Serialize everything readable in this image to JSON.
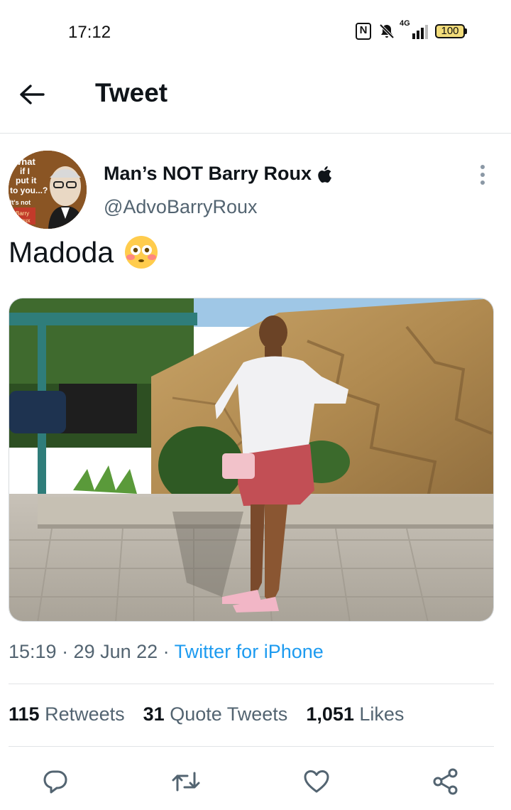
{
  "status_bar": {
    "time": "17:12",
    "network_label": "4G",
    "battery": "100",
    "icons": [
      "nfc-icon",
      "silent-bell-icon",
      "signal-icon",
      "battery-icon"
    ]
  },
  "header": {
    "title": "Tweet",
    "back_icon": "back-arrow-icon"
  },
  "tweet": {
    "author": {
      "display_name": "Man’s NOT Barry Roux",
      "handle": "@AdvoBarryRoux",
      "avatar_caption": [
        "What",
        "if I",
        "put it",
        "to you...?",
        "It's not",
        "Barry",
        "Roux"
      ]
    },
    "text": "Madoda",
    "emoji": "flushed-face",
    "media_alt": "photo",
    "timestamp": "15:19 · 29 Jun 22 · ",
    "source": "Twitter for iPhone",
    "stats": {
      "retweets_count": "115",
      "retweets_label": "Retweets",
      "quotes_count": "31",
      "quotes_label": "Quote Tweets",
      "likes_count": "1,051",
      "likes_label": "Likes"
    },
    "actions": [
      "reply-icon",
      "retweet-icon",
      "like-icon",
      "share-icon"
    ]
  },
  "colors": {
    "text_primary": "#0f1419",
    "text_secondary": "#536471",
    "link": "#1d9bf0",
    "divider": "#e1e4e6"
  }
}
